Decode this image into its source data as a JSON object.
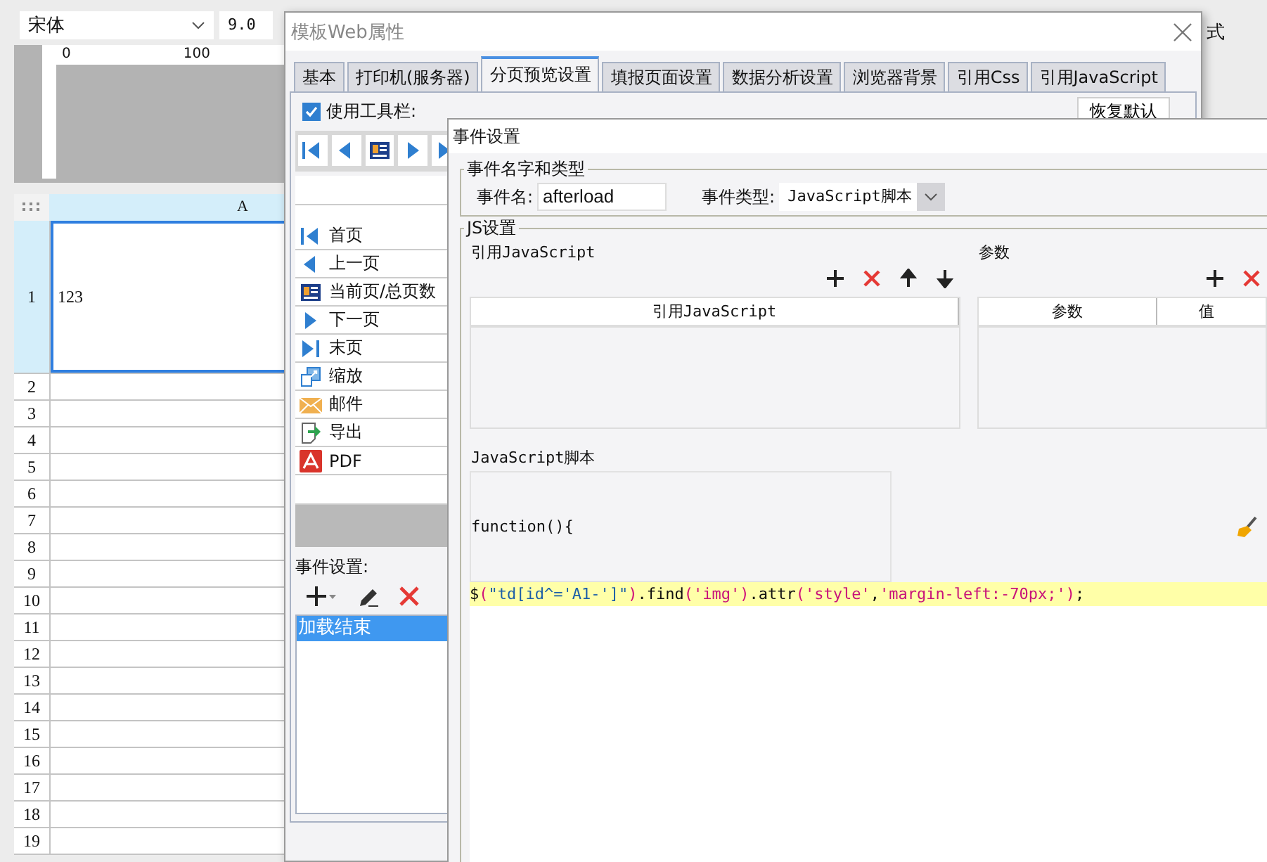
{
  "app": {
    "font_select": {
      "value": "宋体"
    },
    "font_size": {
      "value": "9.0"
    },
    "ruler_labels": [
      "0",
      "100"
    ],
    "side_label": "式",
    "sheet": {
      "column_headers": [
        "A"
      ],
      "rows": [
        {
          "number": "1",
          "cells": [
            "123"
          ],
          "selected": true
        },
        {
          "number": "2",
          "cells": [
            ""
          ],
          "selected": false
        },
        {
          "number": "3",
          "cells": [
            ""
          ],
          "selected": false
        },
        {
          "number": "4",
          "cells": [
            ""
          ],
          "selected": false
        },
        {
          "number": "5",
          "cells": [
            ""
          ],
          "selected": false
        },
        {
          "number": "6",
          "cells": [
            ""
          ],
          "selected": false
        },
        {
          "number": "7",
          "cells": [
            ""
          ],
          "selected": false
        },
        {
          "number": "8",
          "cells": [
            ""
          ],
          "selected": false
        },
        {
          "number": "9",
          "cells": [
            ""
          ],
          "selected": false
        },
        {
          "number": "10",
          "cells": [
            ""
          ],
          "selected": false
        },
        {
          "number": "11",
          "cells": [
            ""
          ],
          "selected": false
        },
        {
          "number": "12",
          "cells": [
            ""
          ],
          "selected": false
        },
        {
          "number": "13",
          "cells": [
            ""
          ],
          "selected": false
        },
        {
          "number": "14",
          "cells": [
            ""
          ],
          "selected": false
        },
        {
          "number": "15",
          "cells": [
            ""
          ],
          "selected": false
        },
        {
          "number": "16",
          "cells": [
            ""
          ],
          "selected": false
        },
        {
          "number": "17",
          "cells": [
            ""
          ],
          "selected": false
        },
        {
          "number": "18",
          "cells": [
            ""
          ],
          "selected": false
        },
        {
          "number": "19",
          "cells": [
            ""
          ],
          "selected": false
        }
      ]
    }
  },
  "web_dialog": {
    "title": "模板Web属性",
    "tabs": [
      {
        "label": "基本",
        "selected": false
      },
      {
        "label": "打印机(服务器)",
        "selected": false
      },
      {
        "label": "分页预览设置",
        "selected": true
      },
      {
        "label": "填报页面设置",
        "selected": false
      },
      {
        "label": "数据分析设置",
        "selected": false
      },
      {
        "label": "浏览器背景",
        "selected": false
      },
      {
        "label": "引用Css",
        "selected": false
      },
      {
        "label": "引用JavaScript",
        "selected": false
      }
    ],
    "use_toolbar": {
      "label": "使用工具栏:",
      "checked": true
    },
    "restore_button": "恢复默认",
    "toolbar_items": [
      {
        "kind": "first",
        "label": "首页"
      },
      {
        "kind": "prev",
        "label": "上一页"
      },
      {
        "kind": "page",
        "label": "当前页/总页数"
      },
      {
        "kind": "next",
        "label": "下一页"
      },
      {
        "kind": "last",
        "label": "末页"
      },
      {
        "kind": "zoom",
        "label": "缩放"
      },
      {
        "kind": "mail",
        "label": "邮件"
      },
      {
        "kind": "export",
        "label": "导出"
      },
      {
        "kind": "pdf",
        "label": "PDF"
      }
    ],
    "event_label": "事件设置:",
    "events": [
      {
        "label": "加载结束",
        "selected": true
      }
    ]
  },
  "event_dialog": {
    "title": "事件设置",
    "name_group": "事件名字和类型",
    "name_label": "事件名:",
    "name_value": "afterload",
    "type_label": "事件类型:",
    "type_value": "JavaScript脚本",
    "js_group": "JS设置",
    "ref_group": "引用JavaScript",
    "ref_columns": [
      "引用JavaScript"
    ],
    "param_group": "参数",
    "param_columns": [
      "参数",
      "值"
    ],
    "script_group": "JavaScript脚本",
    "function_header": "function(){",
    "code": [
      {
        "kind": "plain",
        "text": "$"
      },
      {
        "kind": "paren",
        "text": "("
      },
      {
        "kind": "dq",
        "text": "\"td[id^='A1-']\""
      },
      {
        "kind": "paren",
        "text": ")"
      },
      {
        "kind": "plain",
        "text": ".find"
      },
      {
        "kind": "paren",
        "text": "("
      },
      {
        "kind": "sq",
        "text": "'img'"
      },
      {
        "kind": "paren",
        "text": ")"
      },
      {
        "kind": "plain",
        "text": ".attr"
      },
      {
        "kind": "paren",
        "text": "("
      },
      {
        "kind": "sq",
        "text": "'style'"
      },
      {
        "kind": "plain",
        "text": ","
      },
      {
        "kind": "sq",
        "text": "'margin-left:-70px;'"
      },
      {
        "kind": "paren",
        "text": ")"
      },
      {
        "kind": "plain",
        "text": ";"
      }
    ]
  }
}
